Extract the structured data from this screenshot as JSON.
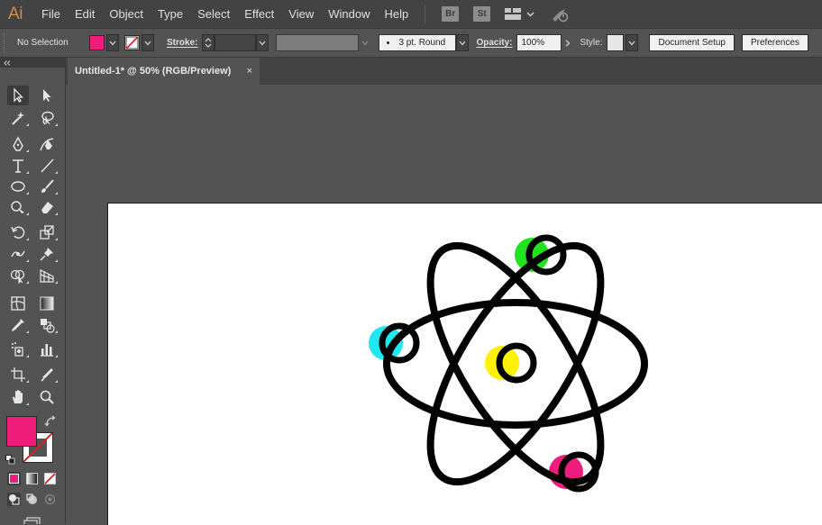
{
  "app": {
    "logo": "Ai"
  },
  "menu": [
    "File",
    "Edit",
    "Object",
    "Type",
    "Select",
    "Effect",
    "View",
    "Window",
    "Help"
  ],
  "app_switcher": {
    "bridge": "Br",
    "stock": "St"
  },
  "control_bar": {
    "selection": "No Selection",
    "fill_color": "#ee1c7b",
    "stroke_label": "Stroke:",
    "brush_value": "3 pt. Round",
    "opacity_label": "Opacity:",
    "opacity_value": "100%",
    "style_label": "Style:",
    "document_setup": "Document Setup",
    "preferences": "Preferences"
  },
  "document_tab": {
    "title": "Untitled-1* @ 50% (RGB/Preview)",
    "close": "×"
  },
  "toolbox": {
    "fill_color": "#ee1c7b",
    "tools": [
      "selection-tool",
      "direct-selection-tool",
      "magic-wand-tool",
      "lasso-tool",
      "pen-tool",
      "curvature-tool",
      "type-tool",
      "line-segment-tool",
      "ellipse-tool",
      "paintbrush-tool",
      "shaper-tool",
      "eraser-tool",
      "rotate-tool",
      "scale-tool",
      "width-tool",
      "puppet-warp-tool",
      "shape-builder-tool",
      "perspective-grid-tool",
      "mesh-tool",
      "gradient-tool",
      "eyedropper-tool",
      "blend-tool",
      "symbol-sprayer-tool",
      "column-graph-tool",
      "artboard-tool",
      "slice-tool",
      "hand-tool",
      "zoom-tool"
    ]
  },
  "artwork": {
    "electron_colors": {
      "top": "#22e41e",
      "left": "#1fe8f0",
      "center": "#fff200",
      "bottom": "#ee1c7b"
    },
    "stroke_color": "#000000"
  }
}
